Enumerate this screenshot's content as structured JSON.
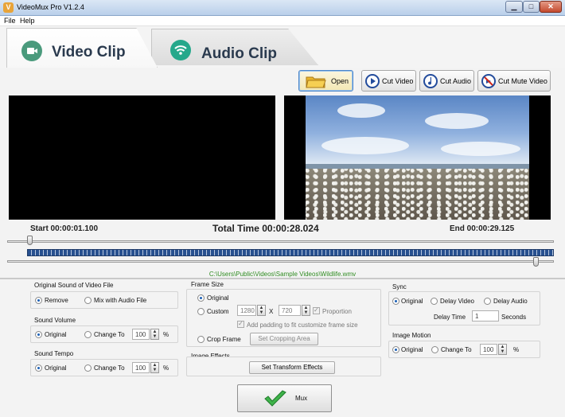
{
  "window": {
    "title": "VideoMux Pro V1.2.4",
    "icon": "app-icon-letter-v",
    "minimize": "▁",
    "maximize": "□",
    "close": "✕"
  },
  "menu": [
    "File",
    "Help"
  ],
  "tabs": [
    {
      "label": "Video Clip",
      "icon": "video-camera-icon",
      "active": true
    },
    {
      "label": "Audio Clip",
      "icon": "wifi-signal-icon",
      "active": false
    }
  ],
  "toolbar": {
    "open": "Open",
    "cut_video": "Cut Video",
    "cut_audio": "Cut Audio",
    "cut_mute_video": "Cut Mute Video"
  },
  "times": {
    "start": "Start 00:00:01.100",
    "total": "Total Time 00:00:28.024",
    "end": "End 00:00:29.125"
  },
  "file_path": "C:\\Users\\Public\\Videos\\Sample Videos\\Wildlife.wmv",
  "original_sound": {
    "title": "Original Sound of Video File",
    "remove": "Remove",
    "mix": "Mix with Audio File",
    "selected": "remove"
  },
  "sound_volume": {
    "title": "Sound Volume",
    "original": "Original",
    "change_to": "Change To",
    "value": "100",
    "unit": "%"
  },
  "sound_tempo": {
    "title": "Sound Tempo",
    "original": "Original",
    "change_to": "Change To",
    "value": "100",
    "unit": "%"
  },
  "frame_size": {
    "title": "Frame Size",
    "original": "Original",
    "custom": "Custom",
    "width": "1280",
    "times": "X",
    "height": "720",
    "proportion": "Proportion",
    "padding": "Add padding to fit customize frame size",
    "crop_frame": "Crop Frame",
    "set_cropping": "Set Cropping Area"
  },
  "image_effects": {
    "title": "Image Effects",
    "button": "Set Transform Effects"
  },
  "sync": {
    "title": "Sync",
    "original": "Original",
    "delay_video": "Delay Video",
    "delay_audio": "Delay Audio",
    "delay_time_label": "Delay Time",
    "delay_value": "1",
    "seconds": "Seconds"
  },
  "image_motion": {
    "title": "Image Motion",
    "original": "Original",
    "change_to": "Change To",
    "value": "100",
    "unit": "%"
  },
  "mux": {
    "label": "Mux"
  },
  "spin_up": "▲",
  "spin_down": "▼",
  "colors": {
    "accent": "#2a3a4e",
    "path_green": "#2e8b20",
    "strip_blue": "#27508f"
  }
}
